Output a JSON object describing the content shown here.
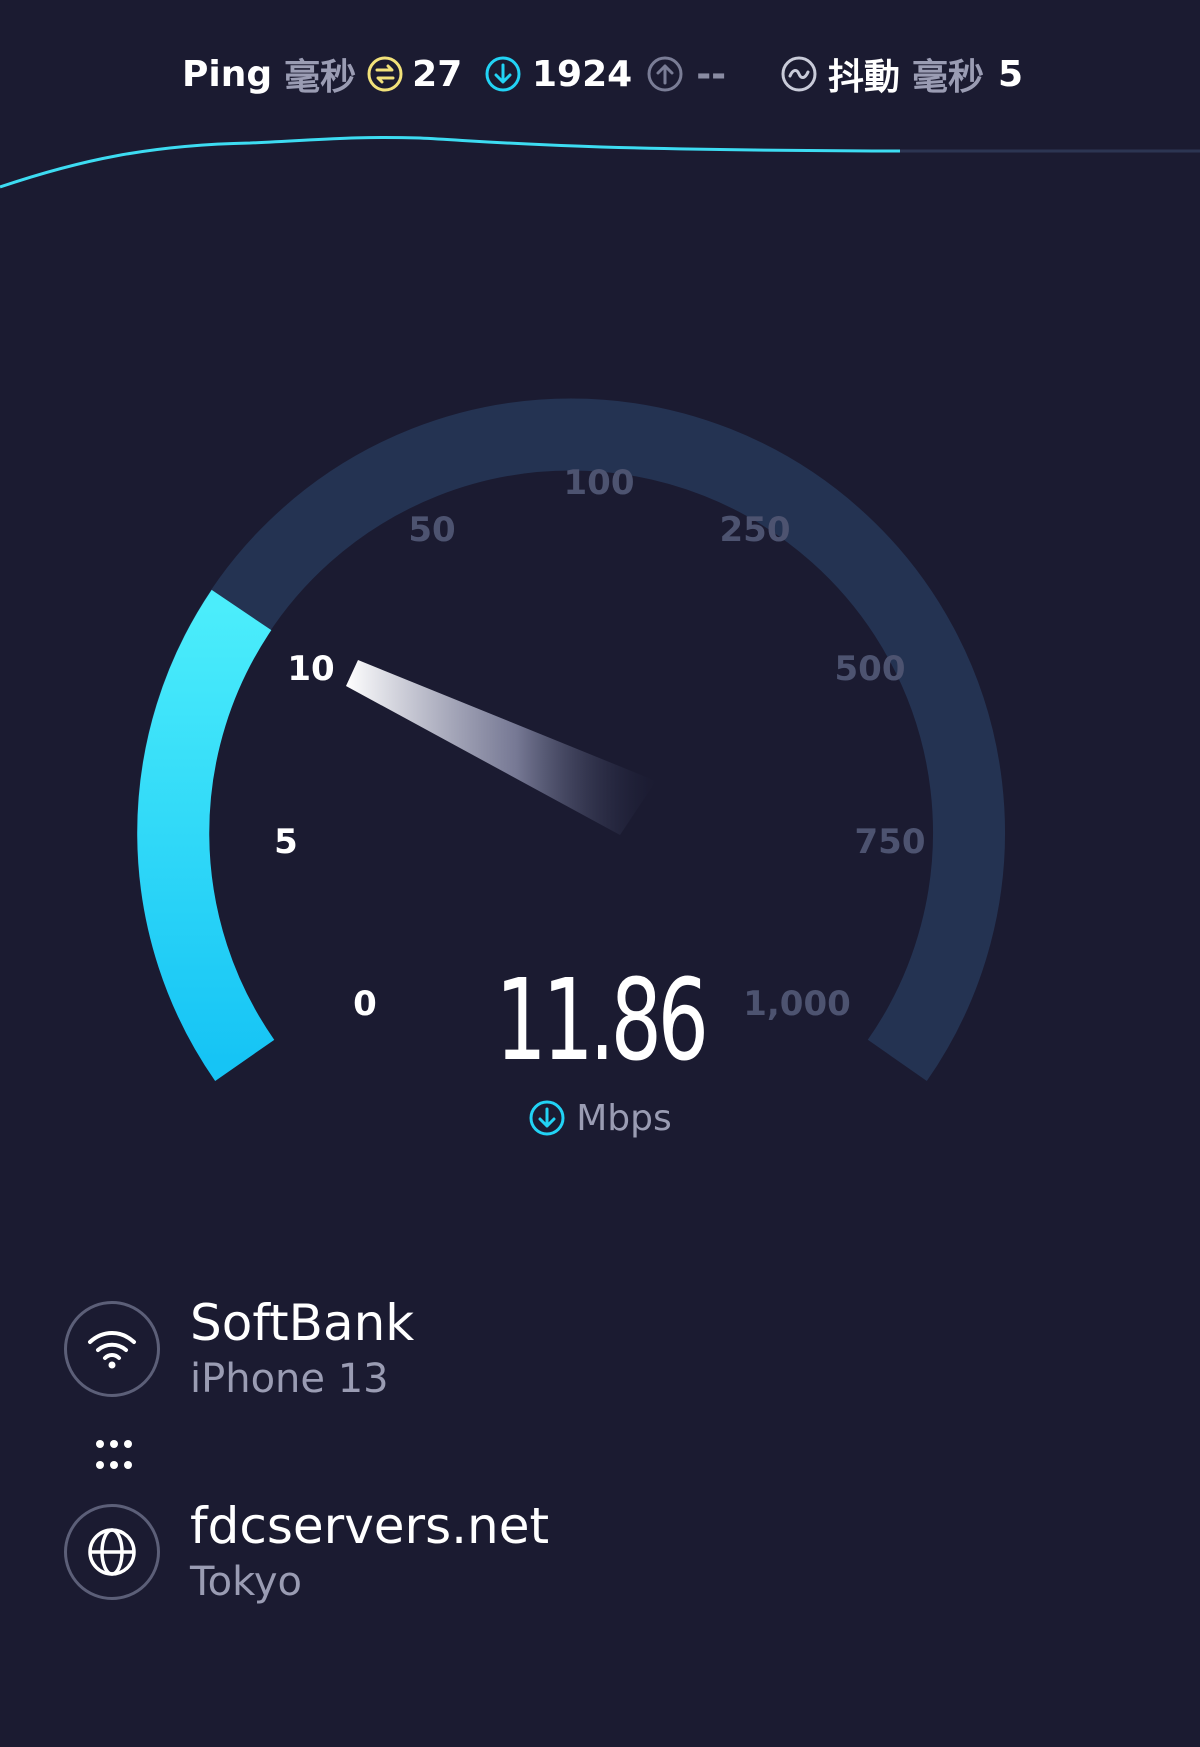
{
  "stats": {
    "ping_label": "Ping",
    "ping_unit": "毫秒",
    "ping_value": "27",
    "download_value": "1924",
    "upload_value": "--",
    "jitter_label": "抖動",
    "jitter_unit": "毫秒",
    "jitter_value": "5"
  },
  "gauge": {
    "ticks": [
      "0",
      "5",
      "10",
      "50",
      "100",
      "250",
      "500",
      "750",
      "1,000"
    ],
    "current_speed": "11.86",
    "unit": "Mbps",
    "progress_fraction": 0.265,
    "colors": {
      "active_arc": "#22d3f5",
      "track": "#243352",
      "needle": "#ffffff"
    }
  },
  "connection": {
    "provider": "SoftBank",
    "device": "iPhone 13",
    "server": "fdcservers.net",
    "location": "Tokyo"
  },
  "icons": {
    "ping": "ping-icon",
    "download": "download-icon",
    "upload": "upload-icon",
    "jitter": "jitter-icon",
    "wifi": "wifi-icon",
    "globe": "globe-icon"
  },
  "colors": {
    "background": "#1b1b31",
    "accent": "#22d3f5",
    "ping_icon": "#f2e27a",
    "muted_text": "#9a9cb3"
  }
}
